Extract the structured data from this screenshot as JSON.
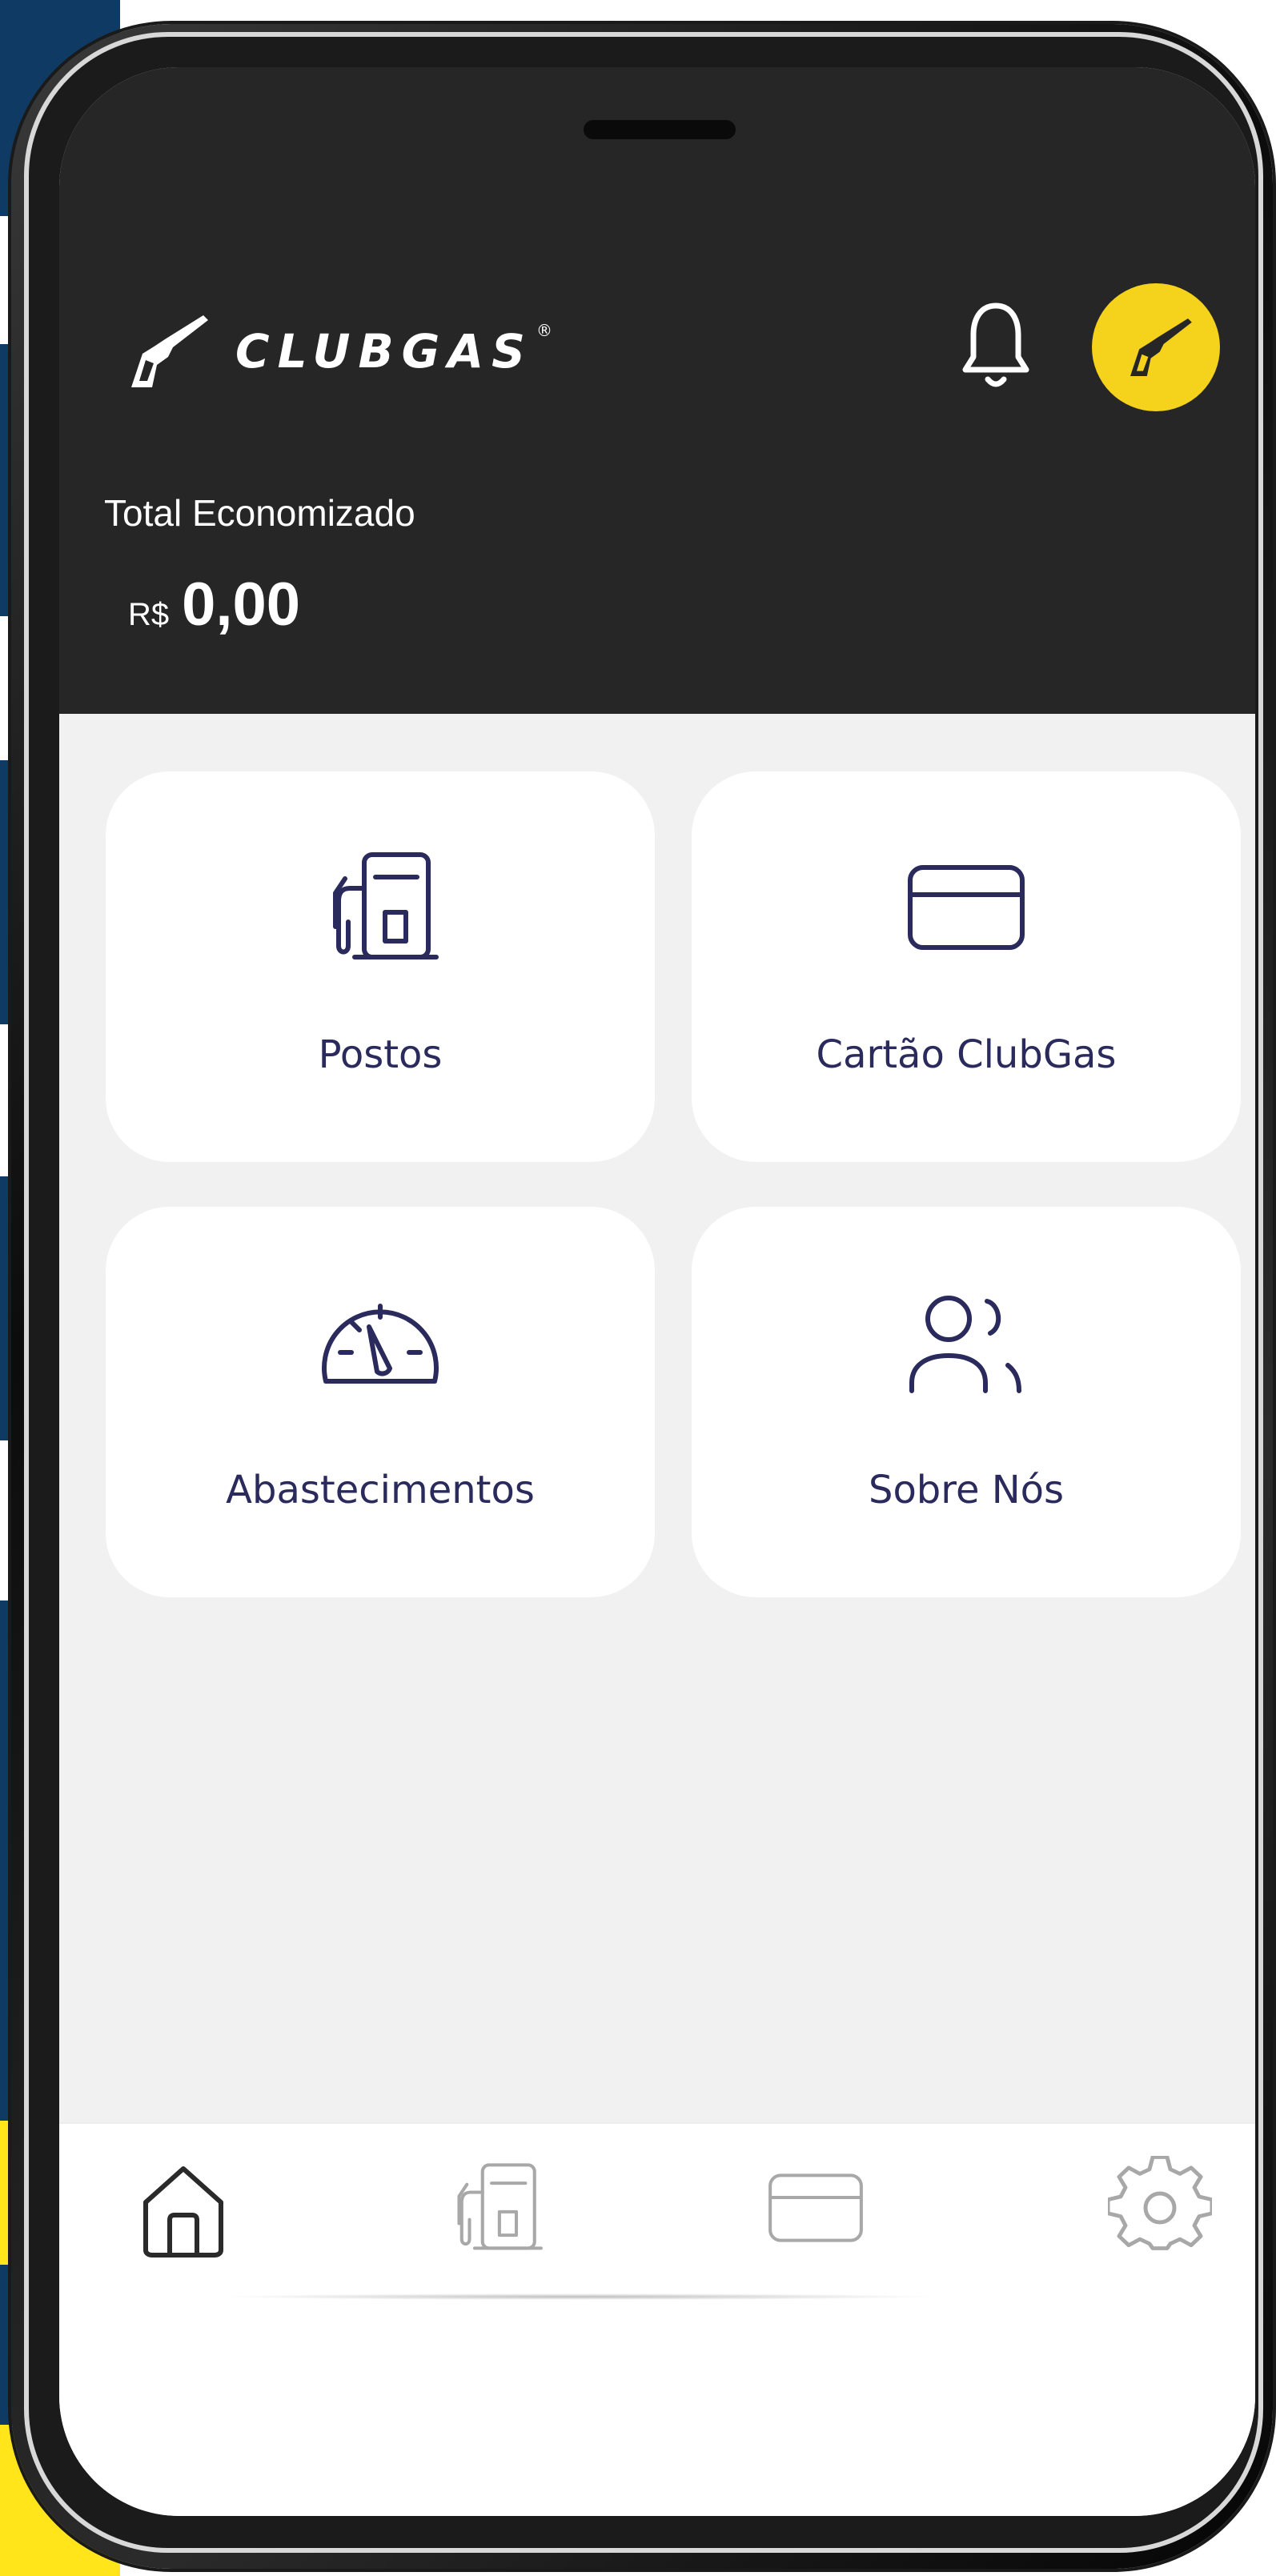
{
  "app": {
    "brand_name": "CLUBGAS",
    "brand_mark": "®"
  },
  "header": {
    "total_label": "Total Economizado",
    "currency": "R$",
    "total_amount": "0,00",
    "icons": {
      "notification": "bell-icon",
      "profile": "avatar-nozzle-icon"
    }
  },
  "menu": [
    {
      "label": "Postos",
      "icon": "fuel-pump-icon"
    },
    {
      "label": "Cartão ClubGas",
      "icon": "credit-card-icon"
    },
    {
      "label": "Abastecimentos",
      "icon": "speedometer-icon"
    },
    {
      "label": "Sobre Nós",
      "icon": "users-icon"
    }
  ],
  "bottom_nav": [
    {
      "icon": "home-icon",
      "active": true
    },
    {
      "icon": "fuel-pump-icon",
      "active": false
    },
    {
      "icon": "credit-card-icon",
      "active": false
    },
    {
      "icon": "gear-icon",
      "active": false
    }
  ],
  "colors": {
    "header_bg": "#262626",
    "accent_yellow": "#f5d21c",
    "navy": "#2a2a5c",
    "background_stripes": "#0f3a63",
    "screen_bg": "#f1f1f1"
  }
}
